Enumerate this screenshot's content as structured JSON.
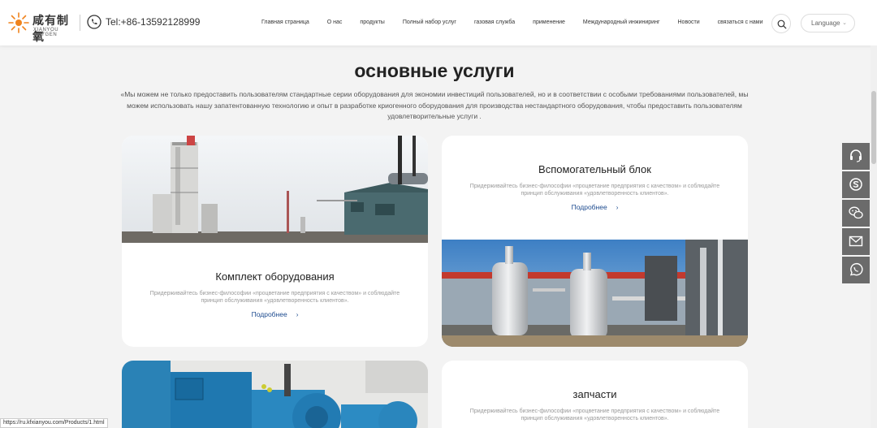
{
  "header": {
    "logo_cn": "咸有制氧",
    "logo_en": "XIANYOU OXYGEN",
    "phone": "Tel:+86-13592128999",
    "nav": [
      "Главная страница",
      "О нас",
      "продукты",
      "Полный набор услуг",
      "газовая служба",
      "применение",
      "Международный инжиниринг",
      "Новости",
      "связаться с нами"
    ],
    "language": "Language"
  },
  "section": {
    "title": "основные услуги",
    "description": "«Мы можем не только предоставить пользователям стандартные серии оборудования для экономии инвестиций пользователей, но и в соответствии с особыми требованиями пользователей, мы можем использовать нашу запатентованную технологию и опыт в разработке криогенного оборудования для производства нестандартного оборудования, чтобы предоставить пользователям удовлетворительные услуги ."
  },
  "cards": [
    {
      "title": "Комплект оборудования",
      "desc": "Придерживайтесь бизнес-философии «процветание предприятия с качеством» и соблюдайте принцип обслуживания «удовлетворенность клиентов».",
      "more": "Подробнее"
    },
    {
      "title": "Вспомогательный блок",
      "desc": "Придерживайтесь бизнес-философии «процветание предприятия с качеством» и соблюдайте принцип обслуживания «удовлетворенность клиентов».",
      "more": "Подробнее"
    },
    {
      "title": "",
      "desc": "",
      "more": ""
    },
    {
      "title": "запчасти",
      "desc": "Придерживайтесь бизнес-философии «процветание предприятия с качеством» и соблюдайте принцип обслуживания «удовлетворенность клиентов».",
      "more": ""
    }
  ],
  "side_icons": [
    "headset-icon",
    "skype-icon",
    "wechat-icon",
    "mail-icon",
    "whatsapp-icon"
  ],
  "status_url": "https://ru.kfxianyou.com/Products/1.html",
  "colors": {
    "accent": "#1d4b8f",
    "logo_orange": "#f0841e",
    "side_bar": "#6b6b6b"
  }
}
